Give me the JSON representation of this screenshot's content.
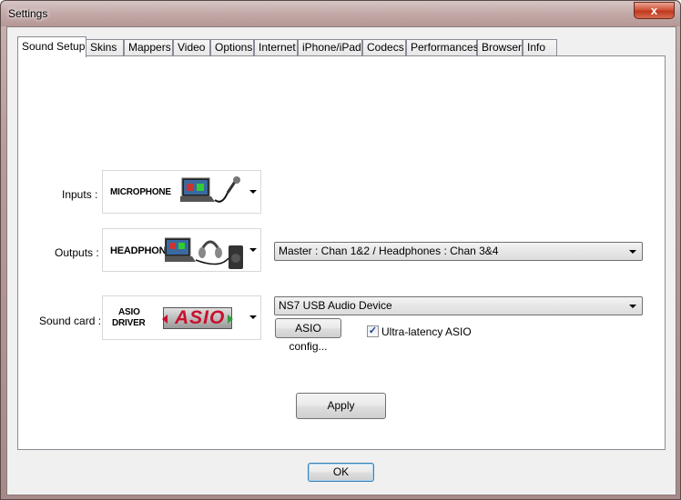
{
  "window": {
    "title": "Settings",
    "close_glyph": "x"
  },
  "tabs": [
    {
      "label": "Sound Setup",
      "active": true
    },
    {
      "label": "Skins"
    },
    {
      "label": "Mappers"
    },
    {
      "label": "Video"
    },
    {
      "label": "Options"
    },
    {
      "label": "Internet"
    },
    {
      "label": "iPhone/iPad"
    },
    {
      "label": "Codecs"
    },
    {
      "label": "Performances"
    },
    {
      "label": "Browser"
    },
    {
      "label": "Info"
    }
  ],
  "sound_setup": {
    "inputs": {
      "label": "Inputs :",
      "image_text": "MICROPHONE",
      "icon": "laptop-microphone-icon"
    },
    "outputs": {
      "label": "Outputs :",
      "image_text": "HEADPHONES",
      "icon": "laptop-headphones-speaker-icon",
      "config_select": "Master : Chan 1&2 / Headphones : Chan 3&4"
    },
    "sound_card": {
      "label": "Sound card :",
      "image_text_line1": "ASIO",
      "image_text_line2": "DRIVER",
      "logo_text": "ASIO",
      "device_select": "NS7 USB Audio Device",
      "asio_config_button": "ASIO config...",
      "ultra_latency": {
        "label": "Ultra-latency ASIO",
        "checked": true,
        "check_glyph": "✓"
      }
    },
    "apply_button": "Apply"
  },
  "footer": {
    "ok_button": "OK"
  },
  "colors": {
    "accent_blue": "#3c7fb1",
    "asio_red": "#c8102e",
    "asio_green": "#2e9e3a"
  }
}
